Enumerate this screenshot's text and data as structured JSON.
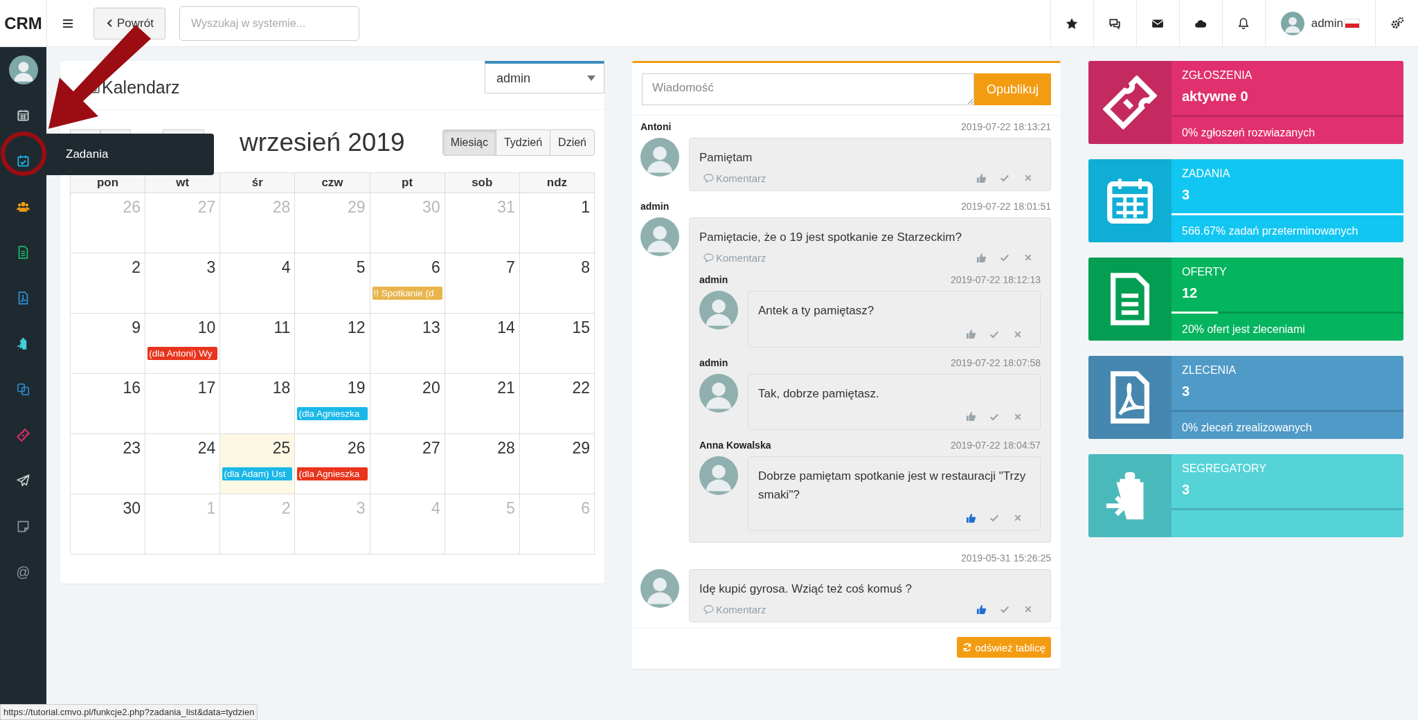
{
  "topbar": {
    "logo": "CRM",
    "back_button": "Powrót",
    "search": {
      "placeholder": "Wyszukaj w systemie..."
    },
    "icons": [
      {
        "kind": "star"
      },
      {
        "kind": "comments"
      },
      {
        "kind": "envelope"
      },
      {
        "kind": "cloud"
      },
      {
        "kind": "bell"
      }
    ],
    "user": {
      "name": "admin"
    }
  },
  "sidebar": {
    "items": [
      {
        "kind": "calendar",
        "color": "#d0d6da"
      },
      {
        "kind": "calendar-check",
        "color": "#1ab8e8"
      },
      {
        "kind": "users",
        "color": "#f39c12"
      },
      {
        "kind": "document",
        "color": "#1db767"
      },
      {
        "kind": "pdf",
        "color": "#2f8fd8"
      },
      {
        "kind": "clipboard",
        "color": "#3fd0d8"
      },
      {
        "kind": "copy",
        "color": "#2f8fd8"
      },
      {
        "kind": "ticket",
        "color": "#e0306e"
      },
      {
        "kind": "plane",
        "color": "#c9d0d4"
      },
      {
        "kind": "note",
        "color": "#8a969c"
      },
      {
        "kind": "at",
        "glyph": "@",
        "color": "#8a969c"
      }
    ],
    "tooltip": "Zadania"
  },
  "calendar": {
    "title": "Kalendarz",
    "user_select": "admin",
    "month": "wrzesień 2019",
    "views": [
      {
        "label": "Miesiąc",
        "selected": true
      },
      {
        "label": "Tydzień",
        "selected": false
      },
      {
        "label": "Dzień",
        "selected": false
      }
    ],
    "weekdays": [
      "pon",
      "wt",
      "śr",
      "czw",
      "pt",
      "sob",
      "ndz"
    ],
    "weeks": [
      [
        {
          "day": "26",
          "other": true
        },
        {
          "day": "27",
          "other": true
        },
        {
          "day": "28",
          "other": true
        },
        {
          "day": "29",
          "other": true
        },
        {
          "day": "30",
          "other": true
        },
        {
          "day": "31",
          "other": true
        },
        {
          "day": "1",
          "other": false
        }
      ],
      [
        {
          "day": "2",
          "other": false
        },
        {
          "day": "3",
          "other": false
        },
        {
          "day": "4",
          "other": false
        },
        {
          "day": "5",
          "other": false
        },
        {
          "day": "6",
          "other": false,
          "event": {
            "text": "!! Spotkanie (d",
            "color": "#e9b44c"
          }
        },
        {
          "day": "7",
          "other": false
        },
        {
          "day": "8",
          "other": false
        }
      ],
      [
        {
          "day": "9",
          "other": false
        },
        {
          "day": "10",
          "other": false,
          "event": {
            "text": "(dla Antoni) Wy",
            "color": "#e8341c"
          }
        },
        {
          "day": "11",
          "other": false
        },
        {
          "day": "12",
          "other": false
        },
        {
          "day": "13",
          "other": false
        },
        {
          "day": "14",
          "other": false
        },
        {
          "day": "15",
          "other": false
        }
      ],
      [
        {
          "day": "16",
          "other": false
        },
        {
          "day": "17",
          "other": false
        },
        {
          "day": "18",
          "other": false
        },
        {
          "day": "19",
          "other": false,
          "event": {
            "text": "(dla Agnieszka",
            "color": "#1ab8e8"
          }
        },
        {
          "day": "20",
          "other": false
        },
        {
          "day": "21",
          "other": false
        },
        {
          "day": "22",
          "other": false
        }
      ],
      [
        {
          "day": "23",
          "other": false
        },
        {
          "day": "24",
          "other": false
        },
        {
          "day": "25",
          "other": false,
          "today": true,
          "event": {
            "text": "(dla Adam) Ust",
            "color": "#1ab8e8"
          }
        },
        {
          "day": "26",
          "other": false,
          "event": {
            "text": "(dla Agnieszka",
            "color": "#e8341c"
          }
        },
        {
          "day": "27",
          "other": false
        },
        {
          "day": "28",
          "other": false
        },
        {
          "day": "29",
          "other": false
        }
      ],
      [
        {
          "day": "30",
          "other": false
        },
        {
          "day": "1",
          "other": true
        },
        {
          "day": "2",
          "other": true
        },
        {
          "day": "3",
          "other": true
        },
        {
          "day": "4",
          "other": true
        },
        {
          "day": "5",
          "other": true
        },
        {
          "day": "6",
          "other": true
        }
      ]
    ]
  },
  "feed": {
    "message": {
      "placeholder": "Wiadomość"
    },
    "publish_button": "Opublikuj",
    "refresh_button": "odśwież tablicę",
    "posts": [
      {
        "author": "Antoni",
        "time": "2019-07-22 18:13:21",
        "text": "Pamiętam",
        "comment_link": "Komentarz",
        "liked": false
      },
      {
        "author": "admin",
        "time": "2019-07-22 18:01:51",
        "text": "Pamiętacie, że o 19 jest spotkanie ze Starzeckim?",
        "comment_link": "Komentarz",
        "liked": false,
        "replies": [
          {
            "author": "admin",
            "time": "2019-07-22 18:12:13",
            "text": "Antek a ty pamiętasz?",
            "liked": false
          },
          {
            "author": "admin",
            "time": "2019-07-22 18:07:58",
            "text": "Tak, dobrze pamiętasz.",
            "liked": false
          },
          {
            "author": "Anna Kowalska",
            "time": "2019-07-22 18:04:57",
            "text": "Dobrze pamiętam spotkanie jest w restauracji \"Trzy smaki\"?",
            "liked": true
          }
        ]
      },
      {
        "time": "2019-05-31 15:26:25",
        "text": "Idę kupić gyrosa. Wziąć też coś komuś ?",
        "comment_link": "Komentarz",
        "liked": true
      }
    ]
  },
  "stats": [
    {
      "kind": "ticket",
      "title": "ZGŁOSZENIA",
      "value": "aktywne 0",
      "level": 0,
      "footer": "0% zgłoszeń rozwiazanych",
      "color": "#e0306e"
    },
    {
      "kind": "calendar",
      "title": "ZADANIA",
      "value": "3",
      "level": 1,
      "footer": "566.67% zadań przeterminowanych",
      "color": "#12c6f2"
    },
    {
      "kind": "document",
      "title": "OFERTY",
      "value": "12",
      "level": 0.2,
      "footer": "20% ofert jest zleceniami",
      "color": "#04b45e"
    },
    {
      "kind": "pdf",
      "title": "ZLECENIA",
      "value": "3",
      "level": 0,
      "footer": "0% zleceń zrealizowanych",
      "color": "#4f9ac6"
    },
    {
      "kind": "clipboard",
      "title": "SEGREGATORY",
      "value": "3",
      "level": 0,
      "color": "#55d3d6"
    }
  ],
  "status_bar": {
    "url": "https://tutorial.cmvo.pl/funkcje2.php?zadania_list&data=tydzien"
  }
}
